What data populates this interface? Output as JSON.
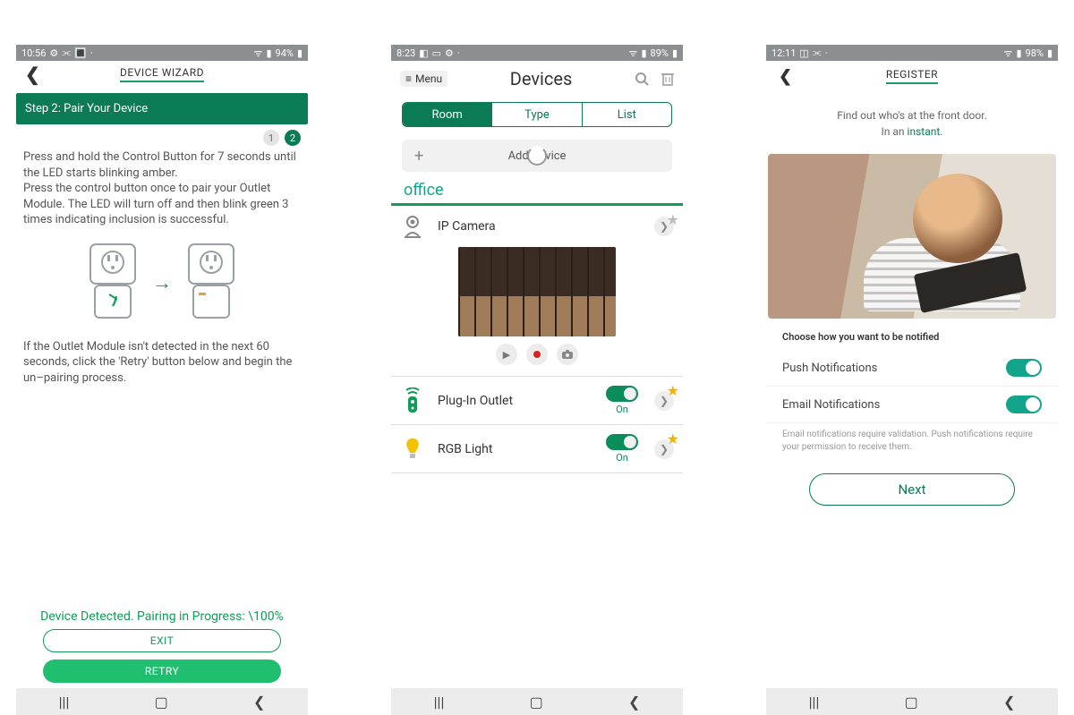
{
  "phone1": {
    "status": {
      "time": "10:56",
      "battery": "94%"
    },
    "header": {
      "title": "DEVICE WIZARD"
    },
    "step_bar": "Step 2: Pair Your Device",
    "steps": {
      "one": "1",
      "two": "2"
    },
    "para1": "Press and hold the Control Button for 7 seconds until the LED starts blinking amber.",
    "para2": "Press the control button once to pair your Outlet Module. The LED will turn off and then blink green 3 times indicating inclusion is successful.",
    "para3": "If the Outlet Module isn't detected in the next 60 seconds, click the 'Retry' button below and begin the un–pairing process.",
    "status_text": "Device Detected. Pairing in Progress: \\100%",
    "exit": "EXIT",
    "retry": "RETRY"
  },
  "phone2": {
    "status": {
      "time": "8:23",
      "battery": "89%"
    },
    "menu_label": "Menu",
    "title": "Devices",
    "tabs": {
      "room": "Room",
      "type": "Type",
      "list": "List"
    },
    "add_device": "Add Device",
    "room_name": "office",
    "devices": {
      "cam": "IP Camera",
      "outlet": "Plug-In Outlet",
      "light": "RGB Light"
    },
    "on_label": "On"
  },
  "phone3": {
    "status": {
      "time": "12:11",
      "battery": "98%"
    },
    "header": {
      "title": "REGISTER"
    },
    "tag_line1": "Find out who's at the front door.",
    "tag_line2_pre": "In an ",
    "tag_line2_em": "instant",
    "tag_line2_post": ".",
    "section_title": "Choose how you want to be notified",
    "push": "Push Notifications",
    "email": "Email Notifications",
    "footnote": "Email notifications require validation. Push notifications require your permission to receive them.",
    "next": "Next"
  }
}
